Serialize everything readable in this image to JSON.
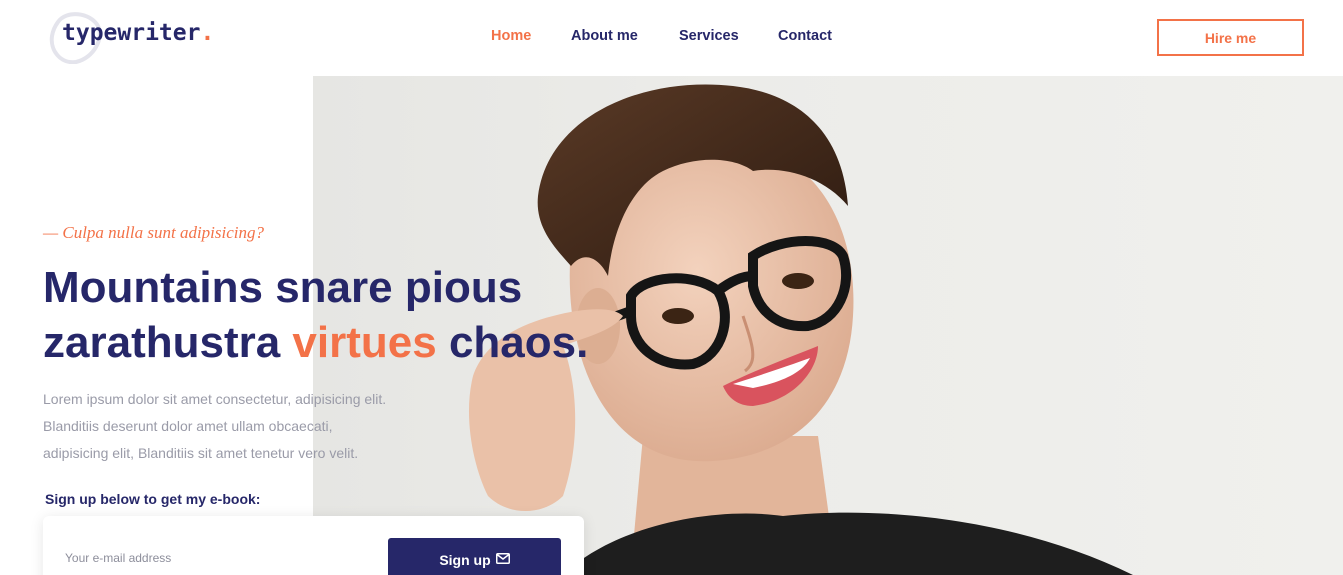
{
  "brand": {
    "name": "typewriter",
    "dot": "."
  },
  "nav": {
    "items": [
      {
        "label": "Home",
        "active": true
      },
      {
        "label": "About me",
        "active": false
      },
      {
        "label": "Services",
        "active": false
      },
      {
        "label": "Contact",
        "active": false
      }
    ],
    "cta_label": "Hire me"
  },
  "hero": {
    "tagline": "— Culpa nulla sunt adipisicing?",
    "headline_line1": "Mountains snare pious",
    "headline_line2_start": "zarathustra",
    "headline_accent": "virtues",
    "headline_line2_end": "chaos.",
    "description": [
      "Lorem ipsum dolor sit amet consectetur, adipisicing elit.",
      "Blanditiis deserunt dolor amet ullam obcaecati,",
      "adipisicing elit, Blanditiis sit amet tenetur vero velit."
    ],
    "signup_label": "Sign up below to get my e-book:",
    "email_placeholder": "Your e-mail address",
    "signup_button": "Sign up",
    "photo_icon": "woman-with-glasses-photo"
  },
  "colors": {
    "primary": "#262769",
    "accent": "#f37248",
    "muted_text": "#9a9ba8"
  }
}
